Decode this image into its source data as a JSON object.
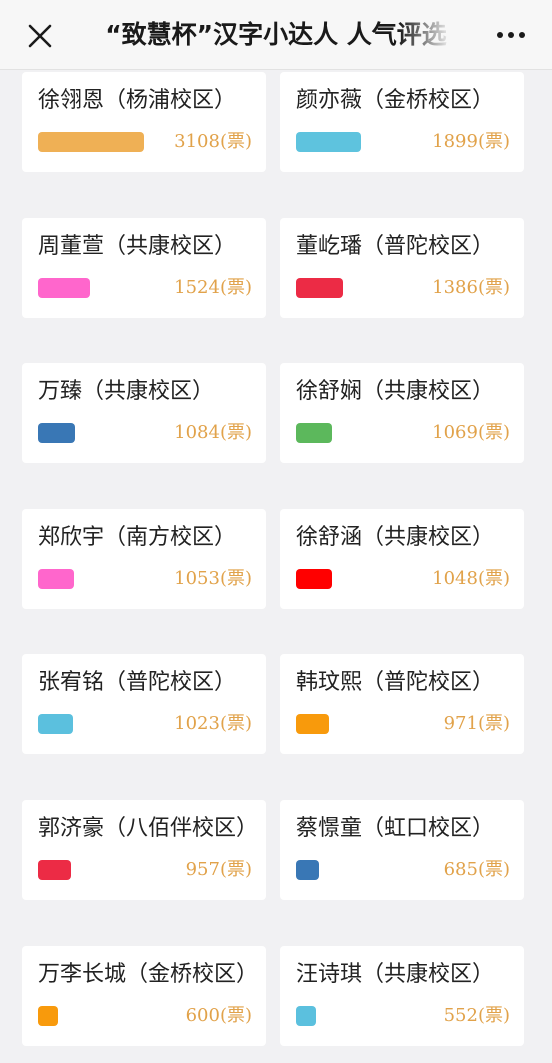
{
  "header": {
    "title": "“致慧杯”汉字小达人 人气评选",
    "close_icon": "close-icon",
    "more_icon": "more-icon"
  },
  "candidates": [
    {
      "name": "徐翎恩（杨浦校区）",
      "votes_text": "3108(票)",
      "votes": 3108,
      "color": "#efb055"
    },
    {
      "name": "颜亦薇（金桥校区）",
      "votes_text": "1899(票)",
      "votes": 1899,
      "color": "#5ec3de"
    },
    {
      "name": "周董萱（共康校区）",
      "votes_text": "1524(票)",
      "votes": 1524,
      "color": "#ff66cc"
    },
    {
      "name": "董屹璠（普陀校区）",
      "votes_text": "1386(票)",
      "votes": 1386,
      "color": "#ec2b45"
    },
    {
      "name": "万臻（共康校区）",
      "votes_text": "1084(票)",
      "votes": 1084,
      "color": "#3977b5"
    },
    {
      "name": "徐舒娴（共康校区）",
      "votes_text": "1069(票)",
      "votes": 1069,
      "color": "#5cb85c"
    },
    {
      "name": "郑欣宇（南方校区）",
      "votes_text": "1053(票)",
      "votes": 1053,
      "color": "#ff66cc"
    },
    {
      "name": "徐舒涵（共康校区）",
      "votes_text": "1048(票)",
      "votes": 1048,
      "color": "#ff0000"
    },
    {
      "name": "张宥铭（普陀校区）",
      "votes_text": "1023(票)",
      "votes": 1023,
      "color": "#5bc0de"
    },
    {
      "name": "韩玟熙（普陀校区）",
      "votes_text": "971(票)",
      "votes": 971,
      "color": "#f89a0c"
    },
    {
      "name": "郭济豪（八佰伴校区）",
      "votes_text": "957(票)",
      "votes": 957,
      "color": "#ec2b45"
    },
    {
      "name": "蔡憬童（虹口校区）",
      "votes_text": "685(票)",
      "votes": 685,
      "color": "#3977b5"
    },
    {
      "name": "万李长城（金桥校区）",
      "votes_text": "600(票)",
      "votes": 600,
      "color": "#f89a0c"
    },
    {
      "name": "汪诗琪（共康校区）",
      "votes_text": "552(票)",
      "votes": 552,
      "color": "#5bc0de"
    }
  ]
}
